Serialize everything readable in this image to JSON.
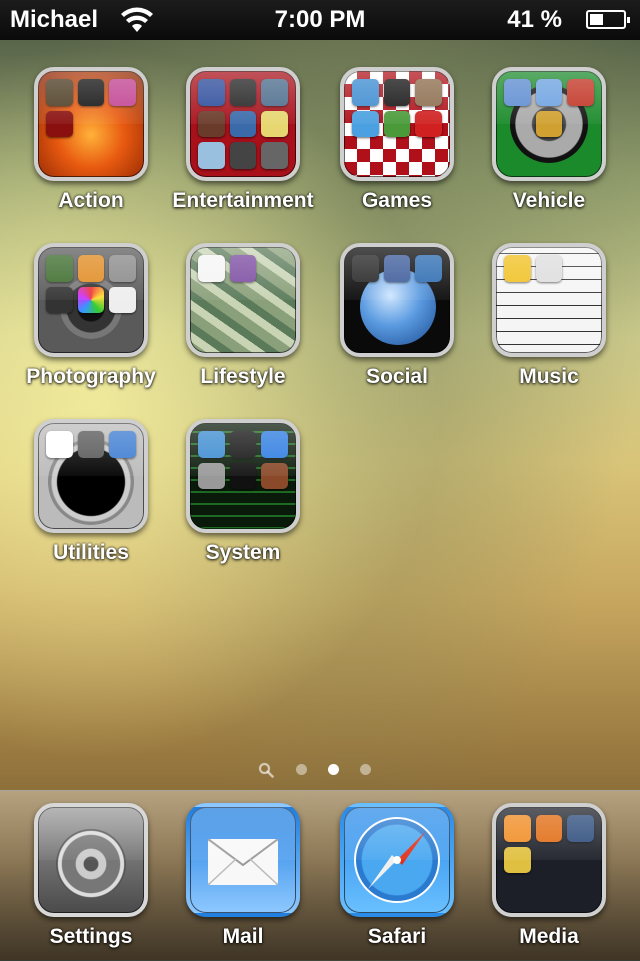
{
  "status_bar": {
    "carrier": "Michael",
    "time": "7:00 PM",
    "battery_percent_text": "41 %",
    "battery_level": 0.41
  },
  "apps": [
    {
      "label": "Action",
      "icon": "action-folder-icon"
    },
    {
      "label": "Entertainment",
      "icon": "entertainment-folder-icon"
    },
    {
      "label": "Games",
      "icon": "games-folder-icon"
    },
    {
      "label": "Vehicle",
      "icon": "vehicle-folder-icon"
    },
    {
      "label": "Photography",
      "icon": "photography-folder-icon"
    },
    {
      "label": "Lifestyle",
      "icon": "lifestyle-folder-icon"
    },
    {
      "label": "Social",
      "icon": "social-folder-icon"
    },
    {
      "label": "Music",
      "icon": "music-folder-icon"
    },
    {
      "label": "Utilities",
      "icon": "utilities-folder-icon"
    },
    {
      "label": "System",
      "icon": "system-folder-icon"
    }
  ],
  "page_indicator": {
    "pages": 3,
    "active": 2
  },
  "dock": [
    {
      "label": "Settings",
      "icon": "settings-icon"
    },
    {
      "label": "Mail",
      "icon": "mail-icon"
    },
    {
      "label": "Safari",
      "icon": "safari-icon"
    },
    {
      "label": "Media",
      "icon": "media-folder-icon"
    }
  ]
}
